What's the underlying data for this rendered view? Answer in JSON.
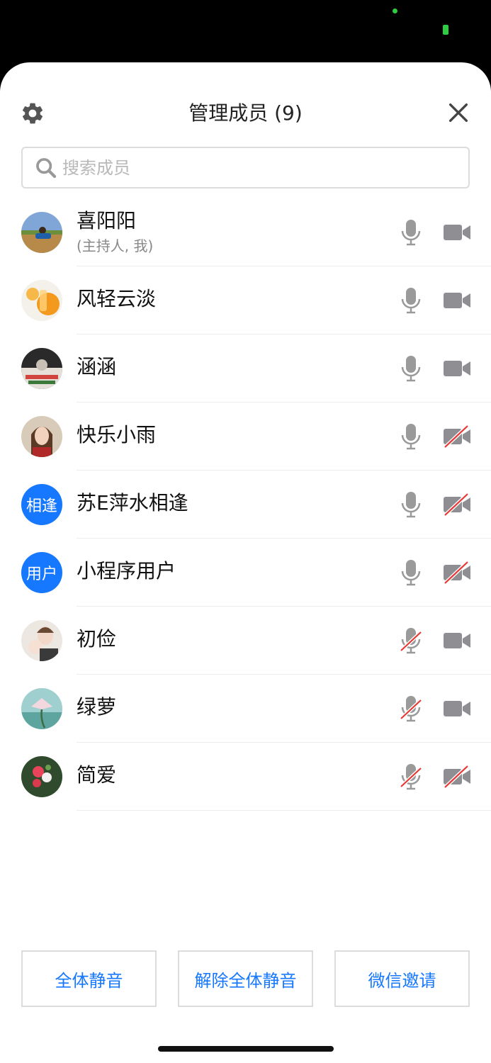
{
  "header": {
    "title": "管理成员 (9)",
    "settings_icon": "gear-icon",
    "close_icon": "close-icon"
  },
  "search": {
    "placeholder": "搜索成员",
    "icon": "search-icon"
  },
  "members": [
    {
      "name": "喜阳阳",
      "subtitle": "(主持人, 我)",
      "avatar": "photo",
      "mic_muted": false,
      "cam_off": false
    },
    {
      "name": "风轻云淡",
      "avatar": "photo",
      "mic_muted": false,
      "cam_off": false
    },
    {
      "name": "涵涵",
      "avatar": "photo",
      "mic_muted": false,
      "cam_off": false
    },
    {
      "name": "快乐小雨",
      "avatar": "photo",
      "mic_muted": false,
      "cam_off": true
    },
    {
      "name": "苏E萍水相逢",
      "avatar_text": "相逢",
      "mic_muted": false,
      "cam_off": true
    },
    {
      "name": "小程序用户",
      "avatar_text": "用户",
      "mic_muted": false,
      "cam_off": true
    },
    {
      "name": "初俭",
      "avatar": "photo",
      "mic_muted": true,
      "cam_off": false
    },
    {
      "name": "绿萝",
      "avatar": "photo",
      "mic_muted": true,
      "cam_off": false
    },
    {
      "name": "简爱",
      "avatar": "photo",
      "mic_muted": true,
      "cam_off": true
    }
  ],
  "footer": {
    "mute_all": "全体静音",
    "unmute_all": "解除全体静音",
    "wechat_invite": "微信邀请"
  },
  "colors": {
    "accent": "#1677ff",
    "icon_gray": "#8e8e93",
    "muted_red": "#e53935"
  }
}
